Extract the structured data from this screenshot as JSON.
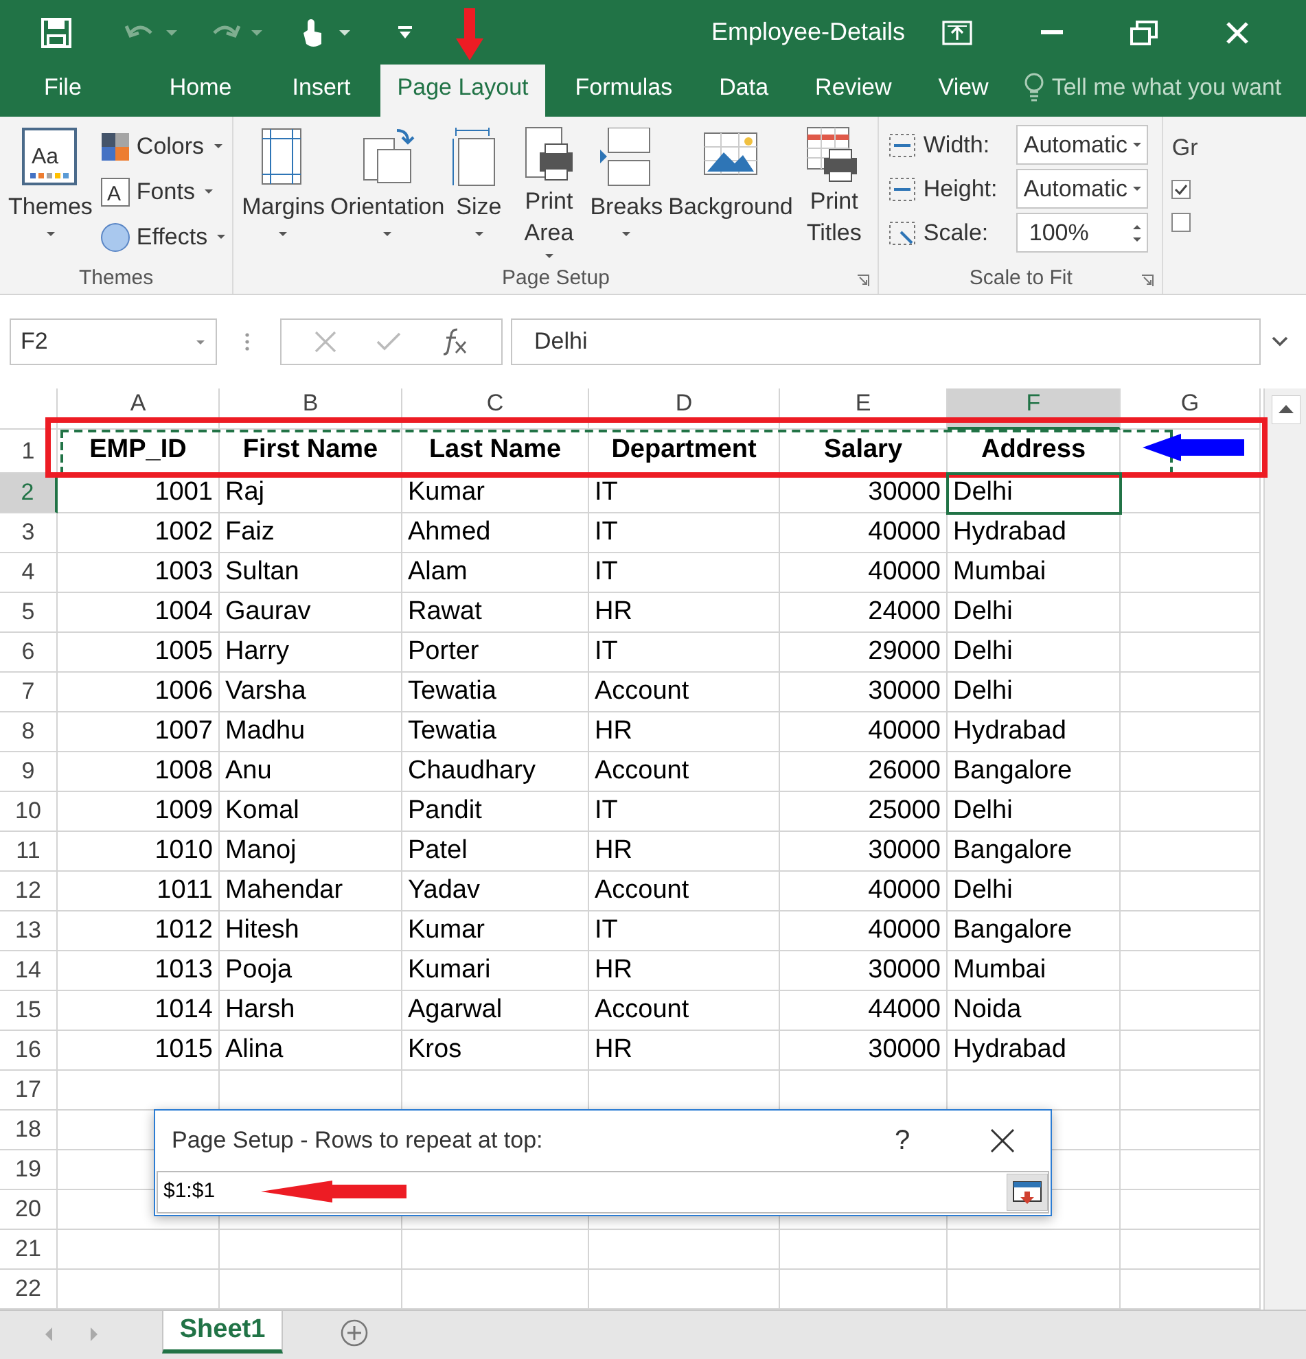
{
  "window": {
    "title": "Employee-Details"
  },
  "tabs": [
    {
      "label": "File",
      "selected": false
    },
    {
      "label": "Home",
      "selected": false
    },
    {
      "label": "Insert",
      "selected": false
    },
    {
      "label": "Page Layout",
      "selected": true
    },
    {
      "label": "Formulas",
      "selected": false
    },
    {
      "label": "Data",
      "selected": false
    },
    {
      "label": "Review",
      "selected": false
    },
    {
      "label": "View",
      "selected": false
    }
  ],
  "tell_me": {
    "placeholder": "Tell me what you want"
  },
  "ribbon": {
    "groups": [
      {
        "label": "Themes",
        "large": [
          {
            "label": "Themes",
            "kind": "themes",
            "dropdown": true,
            "icon_text": "Aa"
          }
        ],
        "small": [
          {
            "label": "Colors",
            "kind": "colors"
          },
          {
            "label": "Fonts",
            "kind": "fonts",
            "icon_text": "A"
          },
          {
            "label": "Effects",
            "kind": "effects"
          }
        ]
      },
      {
        "label": "Page Setup",
        "launcher": true,
        "large": [
          {
            "label": "Margins",
            "kind": "margins",
            "dropdown": true
          },
          {
            "label": "Orientation",
            "kind": "orientation",
            "dropdown": true
          },
          {
            "label": "Size",
            "kind": "size",
            "dropdown": true
          },
          {
            "label": "Print Area",
            "kind": "print-area",
            "dropdown": true
          },
          {
            "label": "Breaks",
            "kind": "breaks",
            "dropdown": true
          },
          {
            "label": "Background",
            "kind": "background",
            "dropdown": false
          },
          {
            "label": "Print Titles",
            "kind": "print-titles",
            "dropdown": false
          }
        ]
      },
      {
        "label": "Scale to Fit",
        "launcher": true,
        "fields": [
          {
            "label": "Width:",
            "value": "Automatic",
            "kind": "dropdown"
          },
          {
            "label": "Height:",
            "value": "Automatic",
            "kind": "dropdown"
          },
          {
            "label": "Scale:",
            "value": "100%",
            "kind": "spinner"
          }
        ]
      },
      {
        "label_cut": "Gr",
        "checkboxes": [
          {
            "checked": true
          },
          {
            "checked": false
          }
        ]
      }
    ]
  },
  "name_box": "F2",
  "formula": "Delhi",
  "columns": [
    {
      "label": "A",
      "kind": "number",
      "selected": false
    },
    {
      "label": "B",
      "kind": "text",
      "selected": false
    },
    {
      "label": "C",
      "kind": "text",
      "selected": false
    },
    {
      "label": "D",
      "kind": "text",
      "selected": false
    },
    {
      "label": "E",
      "kind": "number",
      "selected": false
    },
    {
      "label": "F",
      "kind": "text",
      "selected": true
    },
    {
      "label": "G",
      "kind": "text",
      "selected": false
    }
  ],
  "rows": [
    {
      "number": "1",
      "kind": "header",
      "selected": false,
      "cells": [
        "EMP_ID",
        "First Name",
        "Last Name",
        "Department",
        "Salary",
        "Address"
      ]
    },
    {
      "number": "2",
      "kind": "data",
      "selected": true,
      "cells": [
        "1001",
        "Raj",
        "Kumar",
        "IT",
        "30000",
        "Delhi"
      ]
    },
    {
      "number": "3",
      "kind": "data",
      "selected": false,
      "cells": [
        "1002",
        "Faiz",
        "Ahmed",
        "IT",
        "40000",
        "Hydrabad"
      ]
    },
    {
      "number": "4",
      "kind": "data",
      "selected": false,
      "cells": [
        "1003",
        "Sultan",
        "Alam",
        "IT",
        "40000",
        "Mumbai"
      ]
    },
    {
      "number": "5",
      "kind": "data",
      "selected": false,
      "cells": [
        "1004",
        "Gaurav",
        "Rawat",
        "HR",
        "24000",
        "Delhi"
      ]
    },
    {
      "number": "6",
      "kind": "data",
      "selected": false,
      "cells": [
        "1005",
        "Harry",
        "Porter",
        "IT",
        "29000",
        "Delhi"
      ]
    },
    {
      "number": "7",
      "kind": "data",
      "selected": false,
      "cells": [
        "1006",
        "Varsha",
        "Tewatia",
        "Account",
        "30000",
        "Delhi"
      ]
    },
    {
      "number": "8",
      "kind": "data",
      "selected": false,
      "cells": [
        "1007",
        "Madhu",
        "Tewatia",
        "HR",
        "40000",
        "Hydrabad"
      ]
    },
    {
      "number": "9",
      "kind": "data",
      "selected": false,
      "cells": [
        "1008",
        "Anu",
        "Chaudhary",
        "Account",
        "26000",
        "Bangalore"
      ]
    },
    {
      "number": "10",
      "kind": "data",
      "selected": false,
      "cells": [
        "1009",
        "Komal",
        "Pandit",
        "IT",
        "25000",
        "Delhi"
      ]
    },
    {
      "number": "11",
      "kind": "data",
      "selected": false,
      "cells": [
        "1010",
        "Manoj",
        "Patel",
        "HR",
        "30000",
        "Bangalore"
      ]
    },
    {
      "number": "12",
      "kind": "data",
      "selected": false,
      "cells": [
        "1011",
        "Mahendar",
        "Yadav",
        "Account",
        "40000",
        "Delhi"
      ]
    },
    {
      "number": "13",
      "kind": "data",
      "selected": false,
      "cells": [
        "1012",
        "Hitesh",
        "Kumar",
        "IT",
        "40000",
        "Bangalore"
      ]
    },
    {
      "number": "14",
      "kind": "data",
      "selected": false,
      "cells": [
        "1013",
        "Pooja",
        "Kumari",
        "HR",
        "30000",
        "Mumbai"
      ]
    },
    {
      "number": "15",
      "kind": "data",
      "selected": false,
      "cells": [
        "1014",
        "Harsh",
        "Agarwal",
        "Account",
        "44000",
        "Noida"
      ]
    },
    {
      "number": "16",
      "kind": "data",
      "selected": false,
      "cells": [
        "1015",
        "Alina",
        "Kros",
        "HR",
        "30000",
        "Hydrabad"
      ]
    },
    {
      "number": "17",
      "kind": "data",
      "selected": false
    },
    {
      "number": "18",
      "kind": "data",
      "selected": false
    },
    {
      "number": "19",
      "kind": "data",
      "selected": false
    },
    {
      "number": "20",
      "kind": "data",
      "selected": false
    },
    {
      "number": "21",
      "kind": "data",
      "selected": false
    },
    {
      "number": "22",
      "kind": "data",
      "selected": false
    }
  ],
  "dialog": {
    "title": "Page Setup - Rows to repeat at top:",
    "help": "?",
    "value": "$1:$1"
  },
  "sheet_tabs": [
    {
      "label": "Sheet1",
      "selected": true
    }
  ],
  "annotations": [
    {
      "kind": "title-arrow",
      "color": "#ed1c24"
    },
    {
      "kind": "header-box",
      "color": "#ed1c24"
    },
    {
      "kind": "header-arrow",
      "color": "#0000ff"
    },
    {
      "kind": "dialog-arrow",
      "color": "#ed1c24"
    }
  ]
}
